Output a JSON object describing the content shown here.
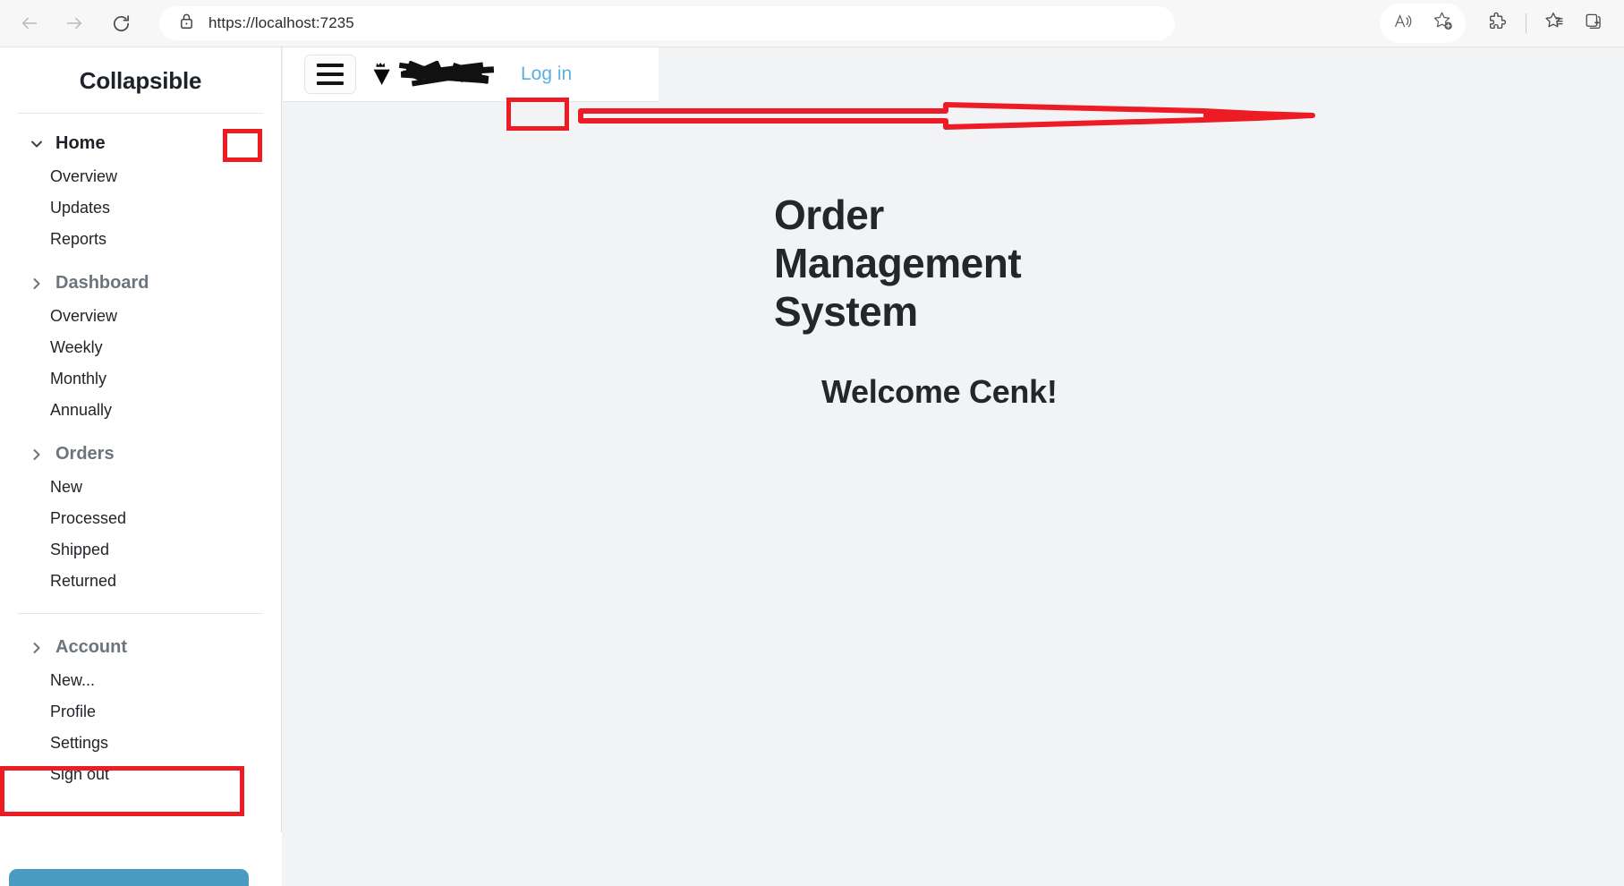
{
  "browser": {
    "url": "https://localhost:7235",
    "nav": {
      "back_label": "Back",
      "forward_label": "Forward",
      "reload_label": "Refresh"
    },
    "icons": {
      "back": "arrow-left-icon",
      "forward": "arrow-right-icon",
      "reload": "refresh-icon",
      "site_info": "lock-icon",
      "read_aloud": "read-aloud-icon",
      "add_favorite": "star-plus-icon",
      "extensions": "puzzle-piece-icon",
      "favorites": "favorites-star-icon",
      "collections": "collections-icon"
    }
  },
  "sidebar": {
    "title": "Collapsible",
    "groups": [
      {
        "label": "Home",
        "state": "expanded",
        "chevron": "chevron-down-icon",
        "items": [
          "Overview",
          "Updates",
          "Reports"
        ]
      },
      {
        "label": "Dashboard",
        "state": "collapsed",
        "chevron": "chevron-right-icon",
        "items": [
          "Overview",
          "Weekly",
          "Monthly",
          "Annually"
        ]
      },
      {
        "label": "Orders",
        "state": "collapsed",
        "chevron": "chevron-right-icon",
        "items": [
          "New",
          "Processed",
          "Shipped",
          "Returned"
        ]
      },
      {
        "label": "Account",
        "state": "collapsed",
        "chevron": "chevron-right-icon",
        "items": [
          "New...",
          "Profile",
          "Settings",
          "Sign out"
        ]
      }
    ],
    "bottom_button_color": "#4a9ac4"
  },
  "topbar": {
    "menu_toggle": "hamburger-menu-icon",
    "brand_icon": "crown-v-logo-icon",
    "brand_name_redacted": "",
    "login_label": "Log in"
  },
  "main": {
    "page_title": "Order Management System",
    "welcome_message": "Welcome Cenk!"
  },
  "annotations": {
    "color": "#ed1c24",
    "shapes": [
      "login-link-highlight-box",
      "sidebar-edge-highlight-box",
      "sidebar-bottom-highlight-box",
      "pointer-arrow-to-login"
    ]
  }
}
